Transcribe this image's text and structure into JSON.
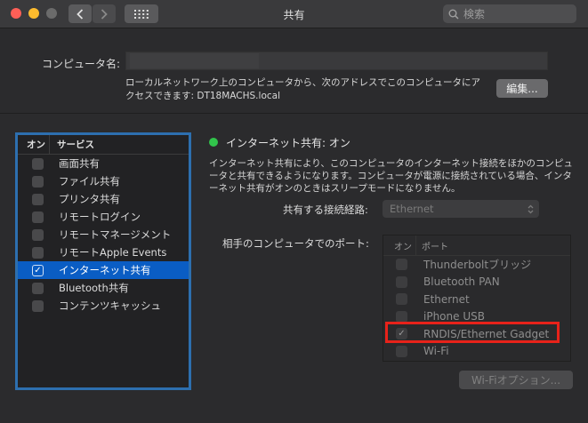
{
  "window": {
    "title": "共有"
  },
  "search": {
    "placeholder": "検索"
  },
  "computer": {
    "label": "コンピュータ名:",
    "name": "",
    "address_text": "ローカルネットワーク上のコンピュータから、次のアドレスでこのコンピュータにアクセスできます: DT18MACHS.local",
    "edit_label": "編集..."
  },
  "services": {
    "header_on": "オン",
    "header_service": "サービス",
    "items": [
      {
        "label": "画面共有",
        "checked": false,
        "selected": false
      },
      {
        "label": "ファイル共有",
        "checked": false,
        "selected": false
      },
      {
        "label": "プリンタ共有",
        "checked": false,
        "selected": false
      },
      {
        "label": "リモートログイン",
        "checked": false,
        "selected": false
      },
      {
        "label": "リモートマネージメント",
        "checked": false,
        "selected": false
      },
      {
        "label": "リモートApple Events",
        "checked": false,
        "selected": false
      },
      {
        "label": "インターネット共有",
        "checked": true,
        "selected": true
      },
      {
        "label": "Bluetooth共有",
        "checked": false,
        "selected": false
      },
      {
        "label": "コンテンツキャッシュ",
        "checked": false,
        "selected": false
      }
    ]
  },
  "sharing": {
    "status": "インターネット共有: オン",
    "status_color": "#31c44b",
    "description": "インターネット共有により、このコンピュータのインターネット接続をほかのコンピュータと共有できるようになります。コンピュータが電源に接続されている場合、インターネット共有がオンのときはスリープモードになりません。",
    "route_label": "共有する接続経路:",
    "route_value": "Ethernet",
    "ports_label": "相手のコンピュータでのポート:",
    "ports_header_on": "オン",
    "ports_header_port": "ポート",
    "ports": [
      {
        "label": "Thunderboltブリッジ",
        "checked": false
      },
      {
        "label": "Bluetooth PAN",
        "checked": false
      },
      {
        "label": "Ethernet",
        "checked": false
      },
      {
        "label": "iPhone USB",
        "checked": false
      },
      {
        "label": "RNDIS/Ethernet Gadget",
        "checked": true
      },
      {
        "label": "Wi-Fi",
        "checked": false
      }
    ],
    "wifi_options_label": "Wi-Fiオプション..."
  },
  "colors": {
    "accent": "#0a5dc4",
    "highlight": "#e8221a",
    "focus_ring": "#2d6faf"
  }
}
